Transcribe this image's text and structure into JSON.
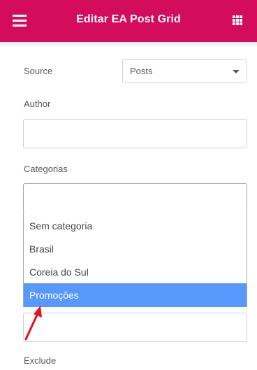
{
  "header": {
    "title": "Editar EA Post Grid",
    "menu_icon": "hamburger-menu-icon",
    "grid_icon": "widgets-grid-icon",
    "background_color": "#d30c5c"
  },
  "source": {
    "label": "Source",
    "selected": "Posts"
  },
  "author": {
    "label": "Author",
    "value": ""
  },
  "categorias": {
    "label": "Categorias",
    "value": "",
    "options": [
      "Sem categoria",
      "Brasil",
      "Coreia do Sul",
      "Promoções"
    ],
    "highlighted_option": "Promoções",
    "highlight_color": "#5897fb"
  },
  "exclude": {
    "label": "Exclude"
  },
  "annotation": {
    "arrow_color": "#e8101e"
  }
}
